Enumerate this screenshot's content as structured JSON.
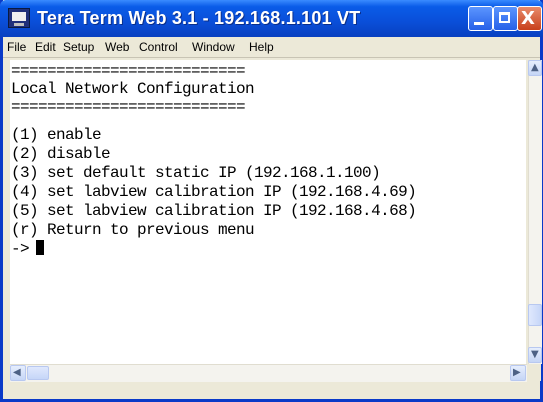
{
  "window": {
    "title": "Tera Term Web 3.1 - 192.168.1.101 VT",
    "close_glyph": "X"
  },
  "menu": {
    "items": [
      "File",
      "Edit",
      "Setup",
      "Web",
      "Control",
      "Window",
      "Help"
    ]
  },
  "terminal": {
    "lines": [
      "==========================",
      "Local Network Configuration",
      "==========================",
      "(1) enable",
      "(2) disable",
      "(3) set default static IP (192.168.1.100)",
      "(4) set labview calibration IP (192.168.4.69)",
      "(5) set labview calibration IP (192.168.4.68)",
      "(r) Return to previous menu"
    ],
    "prompt": "->"
  },
  "icons": {
    "app": "terminal-app-icon",
    "scroll_up": "scroll-up-arrow-icon",
    "scroll_down": "scroll-down-arrow-icon",
    "scroll_left": "scroll-left-arrow-icon",
    "scroll_right": "scroll-right-arrow-icon",
    "resize_grip": "resize-grip-icon"
  },
  "colors": {
    "titlebar": "#0a4ed8",
    "close_button": "#c8401c",
    "terminal_bg": "#ffffff",
    "terminal_text": "#000000"
  }
}
